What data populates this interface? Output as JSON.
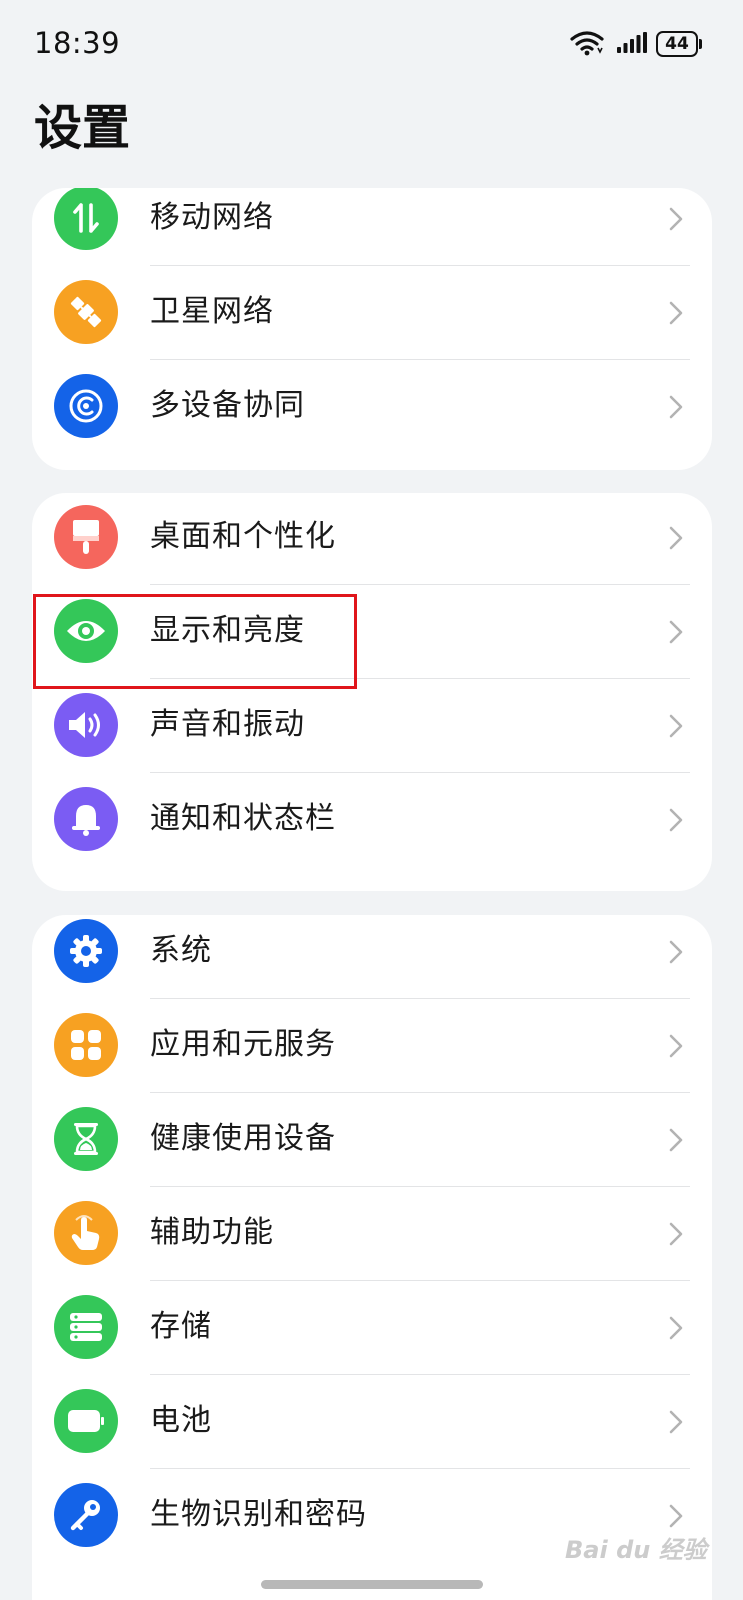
{
  "status_bar": {
    "time": "18:39",
    "battery": "44"
  },
  "page": {
    "title": "设置"
  },
  "groups": [
    {
      "items": [
        {
          "label": "移动网络",
          "icon": "mobile-data-icon",
          "color": "#34c759"
        },
        {
          "label": "卫星网络",
          "icon": "satellite-icon",
          "color": "#f7a122"
        },
        {
          "label": "多设备协同",
          "icon": "multi-device-icon",
          "color": "#1463e8"
        }
      ]
    },
    {
      "items": [
        {
          "label": "桌面和个性化",
          "icon": "paint-brush-icon",
          "color": "#f5665d"
        },
        {
          "label": "显示和亮度",
          "icon": "eye-icon",
          "color": "#34c759",
          "highlighted": true
        },
        {
          "label": "声音和振动",
          "icon": "speaker-icon",
          "color": "#7b5cf3"
        },
        {
          "label": "通知和状态栏",
          "icon": "bell-icon",
          "color": "#7b5cf3"
        }
      ]
    },
    {
      "items": [
        {
          "label": "系统",
          "icon": "gear-icon",
          "color": "#1463e8"
        },
        {
          "label": "应用和元服务",
          "icon": "apps-grid-icon",
          "color": "#f7a122"
        },
        {
          "label": "健康使用设备",
          "icon": "hourglass-icon",
          "color": "#34c759"
        },
        {
          "label": "辅助功能",
          "icon": "hand-pointer-icon",
          "color": "#f7a122"
        },
        {
          "label": "存储",
          "icon": "storage-icon",
          "color": "#34c759"
        },
        {
          "label": "电池",
          "icon": "battery-icon",
          "color": "#34c759"
        },
        {
          "label": "生物识别和密码",
          "icon": "key-icon",
          "color": "#1463e8"
        }
      ]
    }
  ],
  "watermark": "Bai du 经验"
}
